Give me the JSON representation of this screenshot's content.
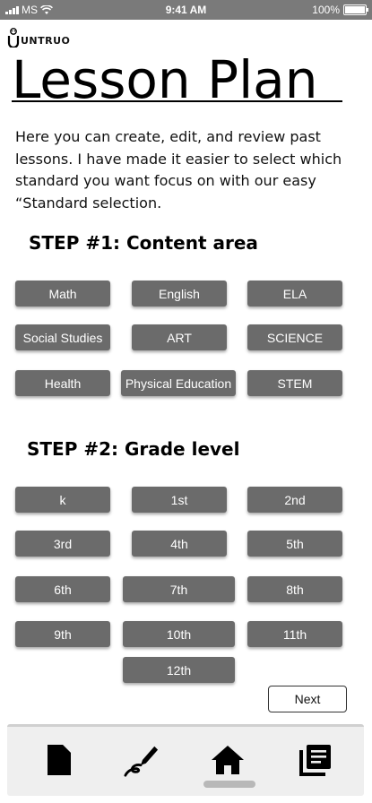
{
  "status_bar": {
    "carrier": "MS",
    "time": "9:41 AM",
    "battery": "100%"
  },
  "logo": {
    "text": "UNTRUO"
  },
  "page": {
    "title": "Lesson Plan",
    "intro": "Here you can create, edit, and review past lessons. I have made it easier to select which standard you want focus on with our easy “Standard selection."
  },
  "step1": {
    "heading": "STEP #1: Content area",
    "options": [
      "Math",
      "English",
      "ELA",
      "Social Studies",
      "ART",
      "SCIENCE",
      "Health",
      "Physical Education",
      "STEM"
    ]
  },
  "step2": {
    "heading": "STEP #2: Grade level",
    "options": [
      "k",
      "1st",
      "2nd",
      "3rd",
      "4th",
      "5th",
      "6th",
      "7th",
      "8th",
      "9th",
      "10th",
      "11th",
      "12th"
    ]
  },
  "next_label": "Next",
  "tab_bar": {
    "items": [
      {
        "icon": "document-icon"
      },
      {
        "icon": "pen-icon"
      },
      {
        "icon": "home-icon"
      },
      {
        "icon": "library-icon"
      }
    ]
  }
}
